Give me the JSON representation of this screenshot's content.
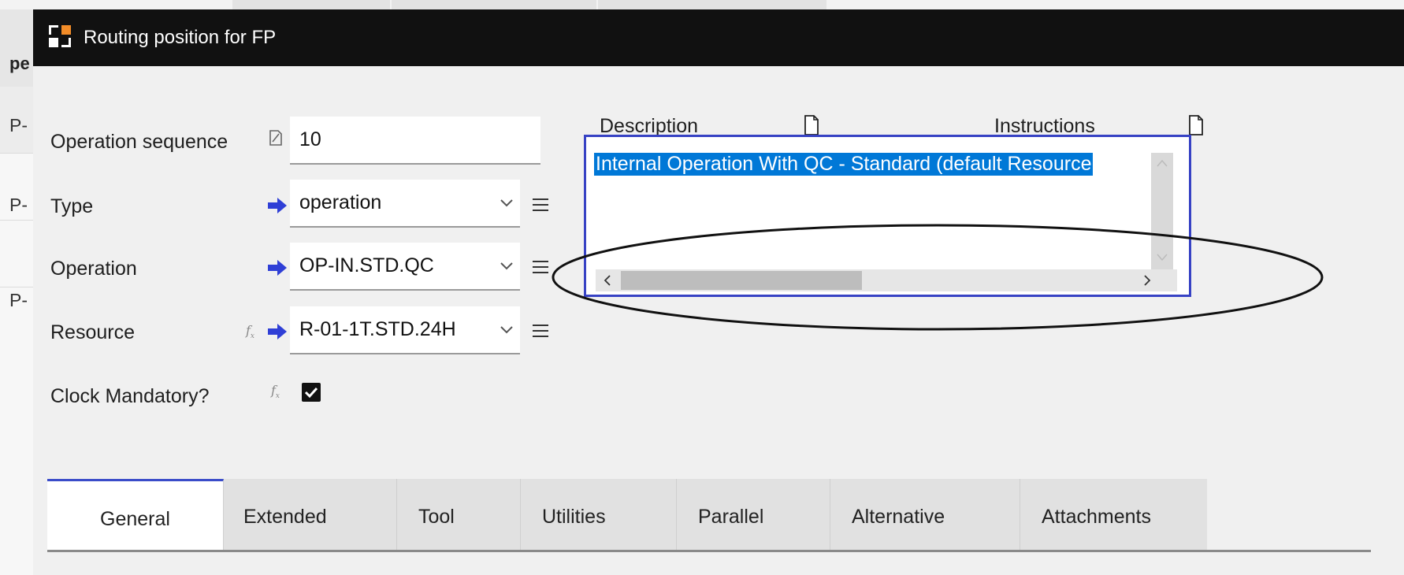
{
  "background": {
    "header_fragment": "pe",
    "row_fragments": [
      "P-",
      "P-",
      "P-"
    ]
  },
  "window": {
    "title": "Routing position for FP"
  },
  "form": {
    "sequence_label": "Operation sequence",
    "sequence_value": "10",
    "type_label": "Type",
    "type_value": "operation",
    "operation_label": "Operation",
    "operation_value": "OP-IN.STD.QC",
    "resource_label": "Resource",
    "resource_value": "R-01-1T.STD.24H",
    "clock_label": "Clock Mandatory?",
    "clock_checked": true,
    "fx_symbol": "f"
  },
  "description": {
    "label": "Description",
    "instructions_label": "Instructions",
    "text": "Internal Operation With QC - Standard (default Resource"
  },
  "tabs": [
    {
      "label": "General",
      "active": true
    },
    {
      "label": "Extended",
      "active": false
    },
    {
      "label": "Tool",
      "active": false
    },
    {
      "label": "Utilities",
      "active": false
    },
    {
      "label": "Parallel",
      "active": false
    },
    {
      "label": "Alternative",
      "active": false
    },
    {
      "label": "Attachments",
      "active": false
    }
  ],
  "colors": {
    "accent": "#3a4cc9",
    "arrow": "#2f3fd6",
    "selection": "#0078d7",
    "titlebar": "#111111"
  }
}
